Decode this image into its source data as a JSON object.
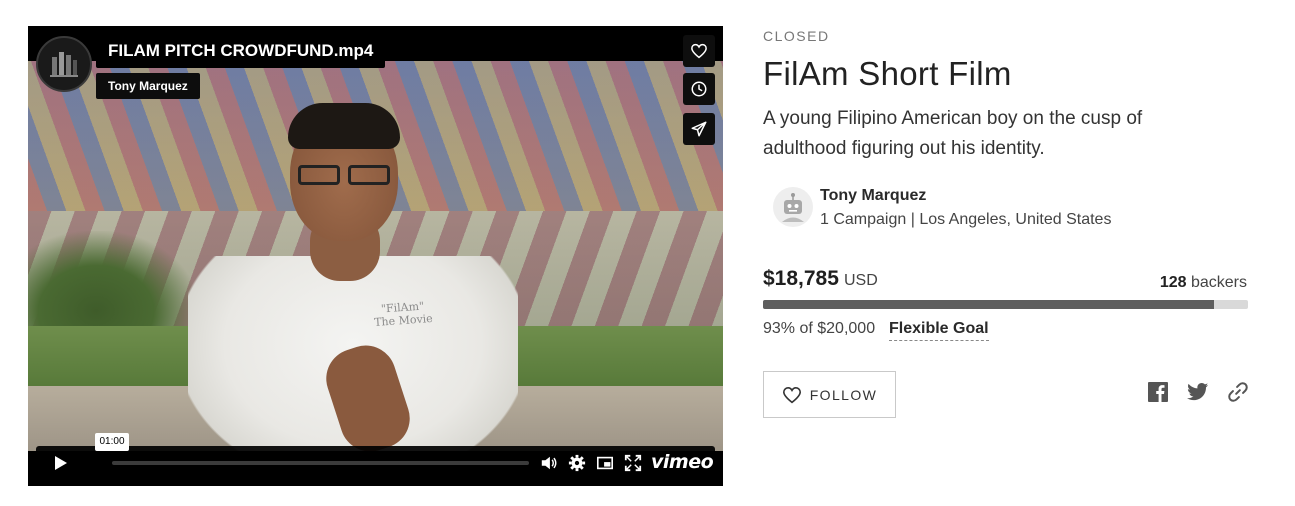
{
  "video": {
    "title": "FILAM PITCH CROWDFUND.mp4",
    "owner": "Tony Marquez",
    "shirt_text_line1": "\"FilAm\"",
    "shirt_text_line2": "The Movie",
    "time_tooltip": "01:00",
    "progress_fraction": 0.0,
    "brand": "vimeo",
    "side_buttons": [
      "heart-icon",
      "clock-icon",
      "paper-plane-icon"
    ],
    "controls": [
      "play-icon",
      "volume-icon",
      "settings-icon",
      "pip-icon",
      "fullscreen-icon"
    ]
  },
  "campaign": {
    "status": "CLOSED",
    "title": "FilAm Short Film",
    "description": "A young Filipino American boy on the cusp of adulthood figuring out his identity.",
    "owner": {
      "name": "Tony Marquez",
      "meta": "1 Campaign | Los Angeles, United States"
    },
    "funding": {
      "raised": "$18,785",
      "currency": "USD",
      "backers_count": "128",
      "backers_label": "backers",
      "percent_text": "93% of $20,000",
      "percent": 93,
      "goal_type": "Flexible Goal"
    },
    "follow_label": "FOLLOW",
    "share_icons": [
      "facebook-icon",
      "twitter-icon",
      "link-icon"
    ]
  },
  "colors": {
    "progress_fill": "#5e5e5e",
    "progress_track": "#d9d9d9",
    "player_bg": "#000000"
  }
}
